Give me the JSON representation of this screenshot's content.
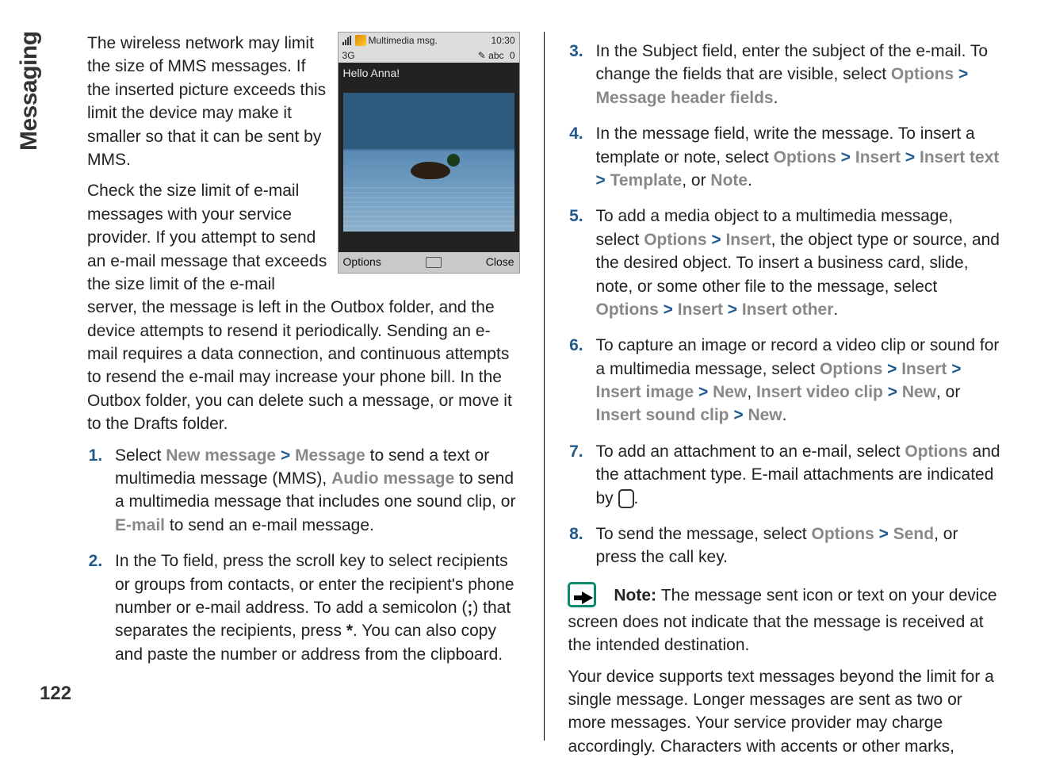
{
  "section_label": "Messaging",
  "page_number": "122",
  "phone": {
    "title": "Multimedia msg.",
    "time": "10:30",
    "network": "3G",
    "mode": "abc",
    "counter": "0",
    "greeting": "Hello Anna!",
    "left_softkey": "Options",
    "right_softkey": "Close"
  },
  "col1": {
    "p1": "The wireless network may limit the size of MMS messages. If the inserted picture exceeds this limit the device may make it smaller so that it can be sent by MMS.",
    "p2": "Check the size limit of e-mail messages with your service provider. If you attempt to send an e-mail message that exceeds the size limit of the e-mail server, the message is left in the Outbox folder, and the device attempts to resend it periodically. Sending an e-mail requires a data connection, and continuous attempts to resend the e-mail may increase your phone bill. In the Outbox folder, you can delete such a message, or move it to the Drafts folder.",
    "li1_a": "Select ",
    "li1_new_message": "New message",
    "li1_b": " > ",
    "li1_message": "Message",
    "li1_c": " to send a text or multimedia message (MMS), ",
    "li1_audio": "Audio message",
    "li1_d": " to send a multimedia message that includes one sound clip, or ",
    "li1_email": "E-mail",
    "li1_e": " to send an e-mail message.",
    "li2_a": "In the To field, press the scroll key to select recipients or groups from contacts, or enter the recipient's phone number or e-mail address. To add a semicolon (",
    "li2_semi": ";",
    "li2_b": ") that separates the recipients, press ",
    "li2_star": "*",
    "li2_c": ". You can also copy and paste the number or address from the clipboard."
  },
  "col2": {
    "li3_a": "In the Subject field, enter the subject of the e-mail. To change the fields that are visible, select ",
    "li3_options": "Options",
    "li3_gt": " > ",
    "li3_mhf": "Message header fields",
    "li3_end": ".",
    "li4_a": "In the message field, write the message. To insert a template or note, select ",
    "li4_options": "Options",
    "li4_gt": " > ",
    "li4_insert": "Insert",
    "li4_gt2": " > ",
    "li4_inserttext": "Insert text",
    "li4_gt3": " > ",
    "li4_template": "Template",
    "li4_or": ", or ",
    "li4_note": "Note",
    "li4_end": ".",
    "li5_a": "To add a media object to a multimedia message, select ",
    "li5_options": "Options",
    "li5_gt": " > ",
    "li5_insert": "Insert",
    "li5_b": ", the object type or source, and the desired object. To insert a business card, slide, note, or some other file to the message, select ",
    "li5_options2": "Options",
    "li5_gt2": " > ",
    "li5_insert2": "Insert",
    "li5_gt3": " > ",
    "li5_insertother": "Insert other",
    "li5_end": ".",
    "li6_a": "To capture an image or record a video clip or sound for a multimedia message, select ",
    "li6_options": "Options",
    "li6_gt": " > ",
    "li6_insert": "Insert",
    "li6_gt2": " > ",
    "li6_insertimage": "Insert image",
    "li6_gt3": " > ",
    "li6_new1": "New",
    "li6_c1": ", ",
    "li6_insertvideo": "Insert video clip",
    "li6_gt4": " > ",
    "li6_new2": "New",
    "li6_c2": ", or ",
    "li6_insertsound": "Insert sound clip",
    "li6_gt5": " > ",
    "li6_new3": "New",
    "li6_end": ".",
    "li7_a": "To add an attachment to an e-mail, select ",
    "li7_options": "Options",
    "li7_b": " and the attachment type. E-mail attachments are indicated by ",
    "li7_end": ".",
    "li8_a": "To send the message, select ",
    "li8_options": "Options",
    "li8_gt": " > ",
    "li8_send": "Send",
    "li8_b": ", or press the call key.",
    "note_label": "Note: ",
    "note_text": "The message sent icon or text on your device screen does not indicate that the message is received at the intended destination.",
    "p_after": "Your device supports text messages beyond the limit for a single message. Longer messages are sent as two or more messages. Your service provider may charge accordingly. Characters with accents or other marks,"
  }
}
